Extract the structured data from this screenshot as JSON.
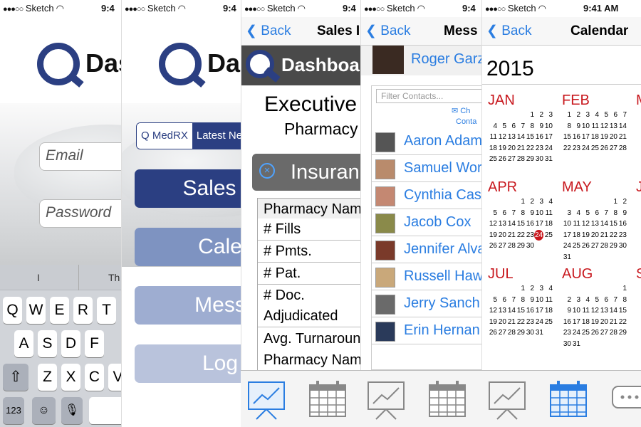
{
  "status": {
    "carrier": "Sketch",
    "time_short": "9:4",
    "time_full": "9:41 AM"
  },
  "p1": {
    "logo": "Das",
    "email_ph": "Email",
    "password_ph": "Password",
    "sugg": [
      "I",
      "Th"
    ],
    "row1": [
      "Q",
      "W",
      "E",
      "R",
      "T"
    ],
    "row2": [
      "A",
      "S",
      "D",
      "F"
    ],
    "row3": [
      "Z",
      "X",
      "C",
      "V"
    ],
    "num": "123"
  },
  "p2": {
    "logo": "Da",
    "seg": [
      "Q MedRX",
      "Latest Ne"
    ],
    "btn_sales": "Sales",
    "btn_cal": "Cale",
    "btn_msg": "Mess",
    "btn_log": "Log"
  },
  "p3": {
    "back": "Back",
    "title": "Sales I",
    "header": "Dashboa",
    "exec": "Executive",
    "pharm": "Pharmacy",
    "insur": "Insuran",
    "rows": [
      "Pharmacy Nam",
      "# Fills",
      "# Pmts.",
      "# Pat.",
      "# Doc.",
      "Adjudicated",
      "Avg. Turnaroun",
      "Pharmacy Nam"
    ]
  },
  "p4": {
    "back": "Back",
    "title": "Mess",
    "me": "Roger Garz",
    "filter_ph": "Filter Contacts...",
    "ch": "Ch",
    "conta": "Conta",
    "contacts": [
      "Aaron Adam",
      "Samuel Wor",
      "Cynthia Cas",
      "Jacob Cox",
      "Jennifer Alva",
      "Russell Haw",
      "Jerry Sanch",
      "Erin Hernan"
    ]
  },
  "p5": {
    "back": "Back",
    "title": "Calendar",
    "year": "2015",
    "months": [
      "JAN",
      "FEB",
      "M",
      "APR",
      "MAY",
      "J",
      "JUL",
      "AUG",
      "S"
    ]
  },
  "colors": {
    "navy": "#2b3f82",
    "ios_blue": "#2a7de1",
    "cal_red": "#c8181e",
    "btn_light": "#7e93c1",
    "btn_pale": "#9eadd1"
  },
  "icons": [
    "chart-icon",
    "calendar-icon",
    "chat-icon",
    "mail-icon",
    "clear-icon",
    "back-chevron-icon"
  ]
}
